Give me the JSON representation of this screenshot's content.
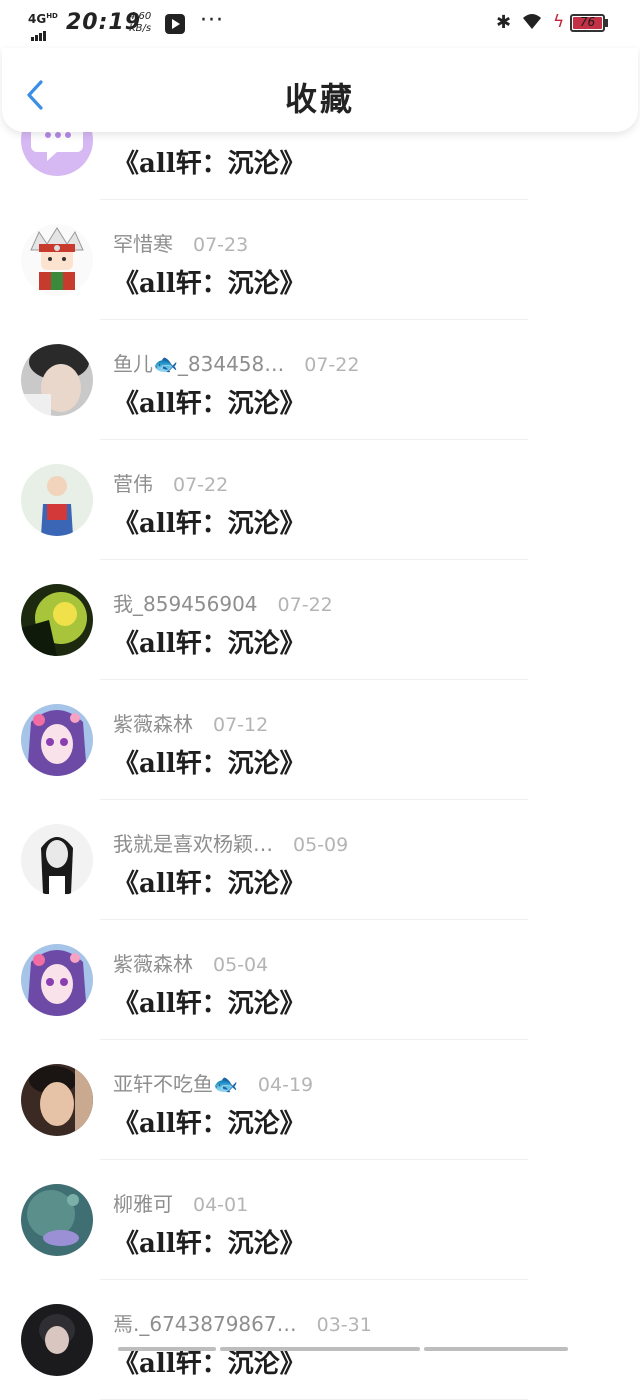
{
  "status_bar": {
    "network": "4G",
    "network_sup": "HD",
    "time": "20:19",
    "speed_value": "4.60",
    "speed_unit": "KB/s",
    "more": "···",
    "battery": "76",
    "bluetooth_glyph": "✱",
    "charging_glyph": "ϟ"
  },
  "header": {
    "title": "收藏",
    "back_icon": "chevron-left-icon"
  },
  "colors": {
    "accent": "#3a8ee6",
    "battery_fill": "#c23145"
  },
  "favorites": [
    {
      "name": "",
      "date": "",
      "work": "《all轩：沉沦》",
      "avatar": "chat-bubble"
    },
    {
      "name": "罕惜寒",
      "date": "07-23",
      "work": "《all轩：沉沦》",
      "avatar": "cartoon-ninja"
    },
    {
      "name": "鱼儿🐟_834458…",
      "date": "07-22",
      "work": "《all轩：沉沦》",
      "avatar": "photo-dark"
    },
    {
      "name": "菅伟",
      "date": "07-22",
      "work": "《all轩：沉沦》",
      "avatar": "photo-child"
    },
    {
      "name": "我_859456904",
      "date": "07-22",
      "work": "《all轩：沉沦》",
      "avatar": "photo-green"
    },
    {
      "name": "紫薇森林",
      "date": "07-12",
      "work": "《all轩：沉沦》",
      "avatar": "anime-purple"
    },
    {
      "name": "我就是喜欢杨颖…",
      "date": "05-09",
      "work": "《all轩：沉沦》",
      "avatar": "photo-bw"
    },
    {
      "name": "紫薇森林",
      "date": "05-04",
      "work": "《all轩：沉沦》",
      "avatar": "anime-purple"
    },
    {
      "name": "亚轩不吃鱼🐟",
      "date": "04-19",
      "work": "《all轩：沉沦》",
      "avatar": "photo-warm"
    },
    {
      "name": "柳雅可",
      "date": "04-01",
      "work": "《all轩：沉沦》",
      "avatar": "photo-teal"
    },
    {
      "name": "焉._6743879867…",
      "date": "03-31",
      "work": "《all轩：沉沦》",
      "avatar": "photo-night"
    }
  ]
}
